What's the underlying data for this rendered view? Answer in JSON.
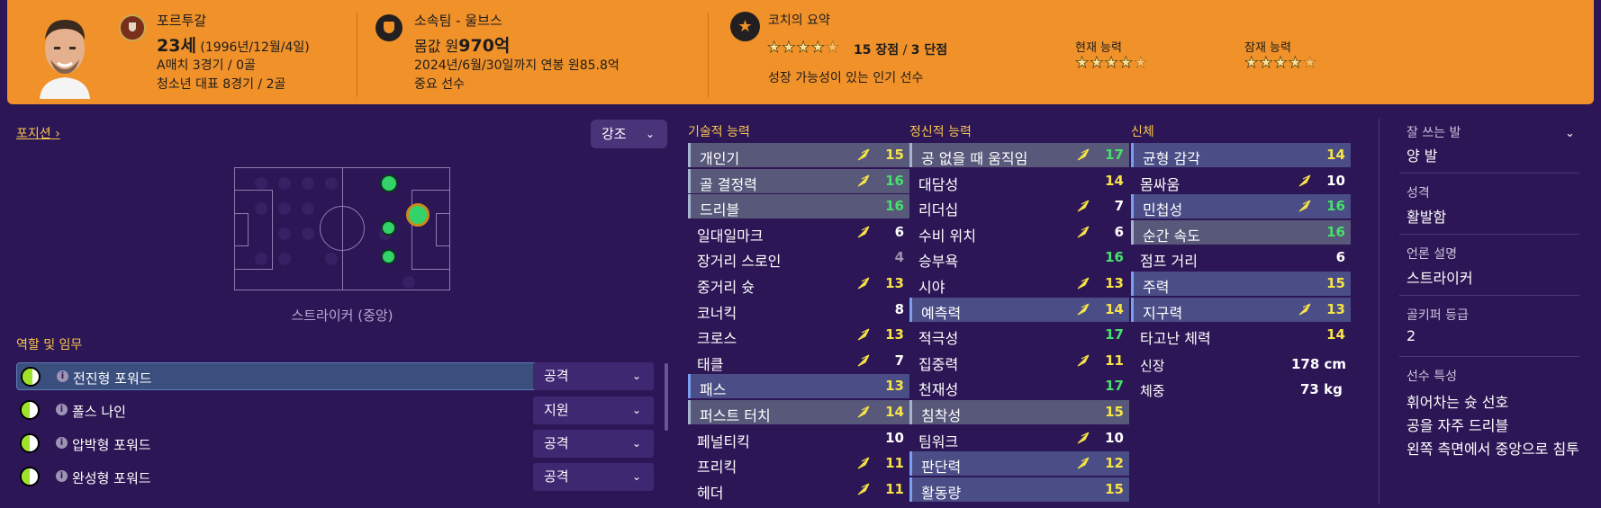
{
  "header": {
    "nationality": "포르투갈",
    "age": "23세",
    "birth": "(1996년/12월/4일)",
    "caps": "A매치 3경기 / 0골",
    "youth_caps": "청소년 대표 8경기 / 2골",
    "club": "소속팀 - 울브스",
    "value_label": "몸값 원",
    "value_amount": "970억",
    "contract": "2024년/6월/30일까지 연봉 원85.8억",
    "squad_status": "중요 선수",
    "coach_summary_title": "코치의 요약",
    "coach_stars": 4.5,
    "strengths": "15 장점",
    "weaknesses": "3 단점",
    "summary_text": "성장 가능성이 있는 인기 선수",
    "current_ability_label": "현재 능력",
    "current_ability_stars": 4.5,
    "potential_ability_label": "잠재 능력",
    "potential_ability_stars": 4.5
  },
  "position": {
    "link_label": "포지션",
    "emphasis_label": "강조",
    "caption": "스트라이커 (중앙)"
  },
  "roles": {
    "title": "역할 및 임무",
    "items": [
      {
        "name": "전진형 포워드",
        "duty": "공격",
        "fill": 0.6
      },
      {
        "name": "폴스 나인",
        "duty": "지원",
        "fill": 0.5
      },
      {
        "name": "압박형 포워드",
        "duty": "공격",
        "fill": 0.5
      },
      {
        "name": "완성형 포워드",
        "duty": "공격",
        "fill": 0.5
      }
    ]
  },
  "technical": {
    "title": "기술적 능력",
    "items": [
      {
        "name": "개인기",
        "value": "15",
        "arrow": true,
        "hl": "hl2"
      },
      {
        "name": "골 결정력",
        "value": "16",
        "arrow": true,
        "hl": "hl2"
      },
      {
        "name": "드리블",
        "value": "16",
        "arrow": false,
        "hl": "hl2"
      },
      {
        "name": "일대일마크",
        "value": "6",
        "arrow": true,
        "hl": ""
      },
      {
        "name": "장거리 스로인",
        "value": "4",
        "arrow": false,
        "hl": ""
      },
      {
        "name": "중거리 슛",
        "value": "13",
        "arrow": true,
        "hl": ""
      },
      {
        "name": "코너킥",
        "value": "8",
        "arrow": false,
        "hl": ""
      },
      {
        "name": "크로스",
        "value": "13",
        "arrow": true,
        "hl": ""
      },
      {
        "name": "태클",
        "value": "7",
        "arrow": true,
        "hl": ""
      },
      {
        "name": "패스",
        "value": "13",
        "arrow": false,
        "hl": "hl"
      },
      {
        "name": "퍼스트 터치",
        "value": "14",
        "arrow": true,
        "hl": "hl2"
      },
      {
        "name": "페널티킥",
        "value": "10",
        "arrow": false,
        "hl": ""
      },
      {
        "name": "프리킥",
        "value": "11",
        "arrow": true,
        "hl": ""
      },
      {
        "name": "헤더",
        "value": "11",
        "arrow": true,
        "hl": ""
      }
    ]
  },
  "mental": {
    "title": "정신적 능력",
    "items": [
      {
        "name": "공 없을 때 움직임",
        "value": "17",
        "arrow": true,
        "hl": "hl2"
      },
      {
        "name": "대담성",
        "value": "14",
        "arrow": false,
        "hl": ""
      },
      {
        "name": "리더십",
        "value": "7",
        "arrow": true,
        "hl": ""
      },
      {
        "name": "수비 위치",
        "value": "6",
        "arrow": true,
        "hl": ""
      },
      {
        "name": "승부욕",
        "value": "16",
        "arrow": false,
        "hl": ""
      },
      {
        "name": "시야",
        "value": "13",
        "arrow": true,
        "hl": ""
      },
      {
        "name": "예측력",
        "value": "14",
        "arrow": true,
        "hl": "hl"
      },
      {
        "name": "적극성",
        "value": "17",
        "arrow": false,
        "hl": ""
      },
      {
        "name": "집중력",
        "value": "11",
        "arrow": true,
        "hl": ""
      },
      {
        "name": "천재성",
        "value": "17",
        "arrow": false,
        "hl": ""
      },
      {
        "name": "침착성",
        "value": "15",
        "arrow": false,
        "hl": "hl2"
      },
      {
        "name": "팀워크",
        "value": "10",
        "arrow": true,
        "hl": ""
      },
      {
        "name": "판단력",
        "value": "12",
        "arrow": true,
        "hl": "hl"
      },
      {
        "name": "활동량",
        "value": "15",
        "arrow": false,
        "hl": "hl"
      }
    ]
  },
  "physical": {
    "title": "신체",
    "items": [
      {
        "name": "균형 감각",
        "value": "14",
        "arrow": false,
        "hl": "hl"
      },
      {
        "name": "몸싸움",
        "value": "10",
        "arrow": true,
        "hl": ""
      },
      {
        "name": "민첩성",
        "value": "16",
        "arrow": true,
        "hl": "hl"
      },
      {
        "name": "순간 속도",
        "value": "16",
        "arrow": false,
        "hl": "hl2"
      },
      {
        "name": "점프 거리",
        "value": "6",
        "arrow": false,
        "hl": ""
      },
      {
        "name": "주력",
        "value": "15",
        "arrow": false,
        "hl": "hl"
      },
      {
        "name": "지구력",
        "value": "13",
        "arrow": true,
        "hl": "hl"
      },
      {
        "name": "타고난 체력",
        "value": "14",
        "arrow": false,
        "hl": ""
      }
    ],
    "height_label": "신장",
    "height_value": "178 cm",
    "weight_label": "체중",
    "weight_value": "73 kg"
  },
  "info": {
    "foot_label": "잘 쓰는 발",
    "foot_value": "양 발",
    "personality_label": "성격",
    "personality_value": "활발함",
    "media_label": "언론 설명",
    "media_value": "스트라이커",
    "gk_label": "골키퍼 등급",
    "gk_value": "2",
    "traits_label": "선수 특성",
    "traits": [
      "휘어차는 슛 선호",
      "공을 자주 드리블",
      "왼쪽 측면에서 중앙으로 침투"
    ]
  },
  "colors": {
    "header": "#f0912a",
    "background": "#2d1656",
    "accent_yellow": "#f7c64a",
    "value_green": "#47e06c",
    "value_yellow": "#f6e347",
    "arrow": "#f6e347"
  }
}
